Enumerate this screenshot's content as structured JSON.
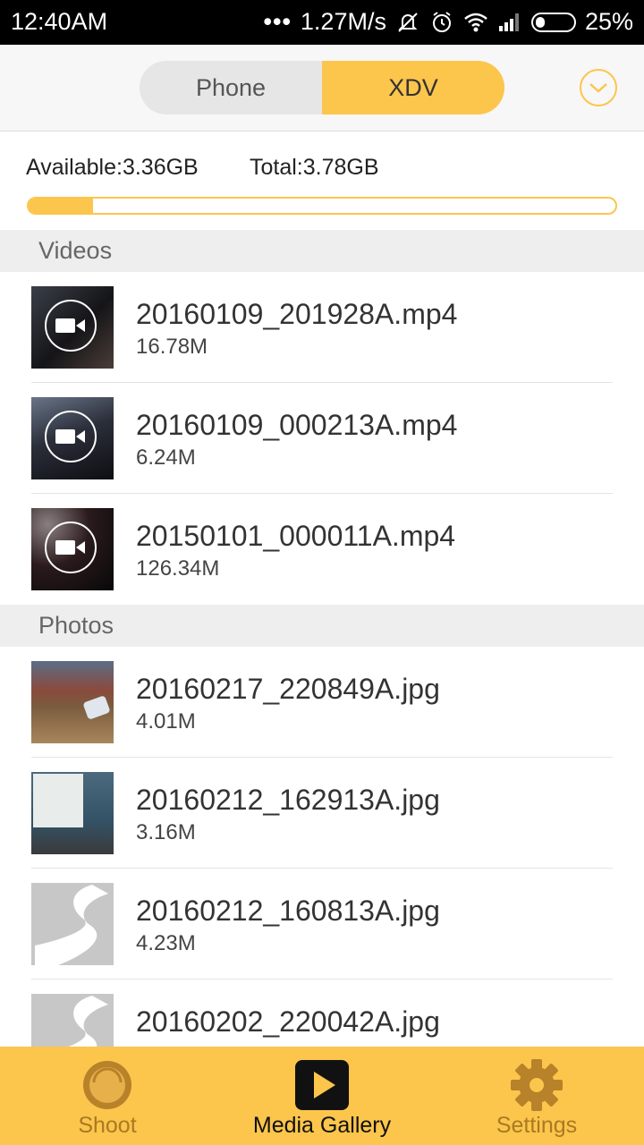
{
  "status_bar": {
    "time": "12:40AM",
    "network_dots": "•••",
    "speed": "1.27M/s",
    "battery": "25%",
    "icons": [
      "muted-bell-icon",
      "alarm-icon",
      "wifi-icon",
      "signal-icon",
      "battery-icon"
    ]
  },
  "header": {
    "tabs": [
      {
        "label": "Phone",
        "active": false
      },
      {
        "label": "XDV",
        "active": true
      }
    ],
    "dropdown_icon": "chevron-down-icon"
  },
  "storage": {
    "available": "Available:3.36GB",
    "total": "Total:3.78GB",
    "used_fraction": 0.11
  },
  "sections": {
    "videos": {
      "title": "Videos",
      "items": [
        {
          "name": "20160109_201928A.mp4",
          "size": "16.78M"
        },
        {
          "name": "20160109_000213A.mp4",
          "size": "6.24M"
        },
        {
          "name": "20150101_000011A.mp4",
          "size": "126.34M"
        }
      ]
    },
    "photos": {
      "title": "Photos",
      "items": [
        {
          "name": "20160217_220849A.jpg",
          "size": "4.01M"
        },
        {
          "name": "20160212_162913A.jpg",
          "size": "3.16M"
        },
        {
          "name": "20160212_160813A.jpg",
          "size": "4.23M"
        },
        {
          "name": "20160202_220042A.jpg",
          "size": ""
        }
      ]
    }
  },
  "bottom_nav": {
    "items": [
      {
        "label": "Shoot",
        "icon": "camera-lens-icon",
        "active": false
      },
      {
        "label": "Media Gallery",
        "icon": "play-icon",
        "active": true
      },
      {
        "label": "Settings",
        "icon": "gear-icon",
        "active": false
      }
    ]
  },
  "colors": {
    "accent": "#fcc54c",
    "inactive_nav": "#a87a22"
  }
}
